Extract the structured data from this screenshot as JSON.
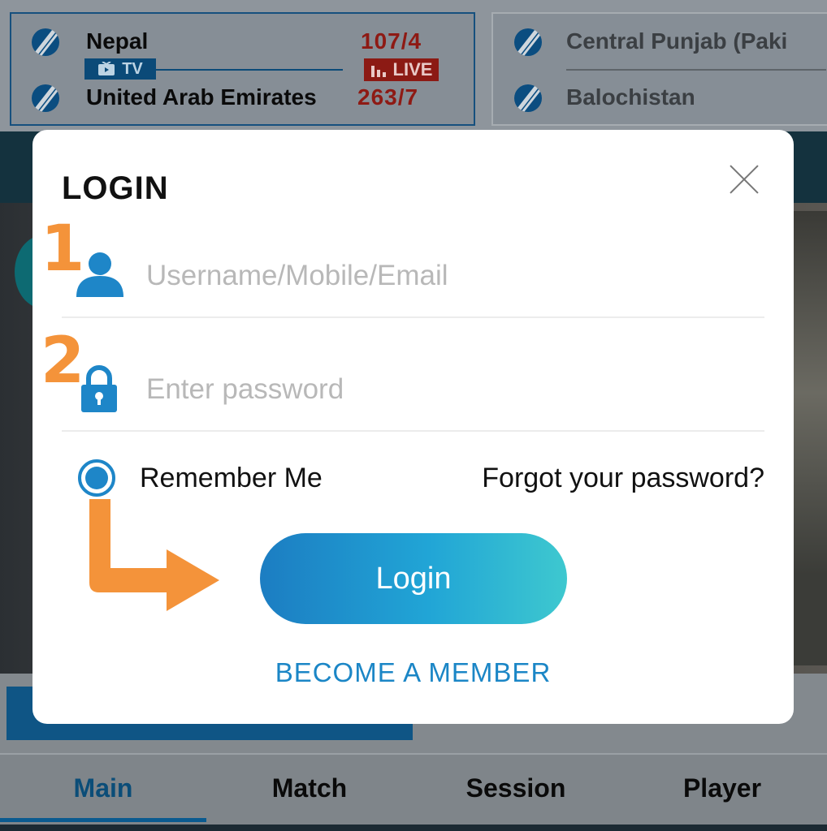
{
  "scoreboard": {
    "left_card": {
      "team1": "Nepal",
      "team1_score": "107/4",
      "team2": "United Arab Emirates",
      "team2_score": "263/7",
      "tv_label": "TV",
      "live_label": "LIVE"
    },
    "right_card": {
      "team1": "Central Punjab (Paki",
      "team2": "Balochistan"
    }
  },
  "login_modal": {
    "title": "LOGIN",
    "step1": "1",
    "step2": "2",
    "username_placeholder": "Username/Mobile/Email",
    "password_placeholder": "Enter password",
    "remember_label": "Remember Me",
    "forgot_label": "Forgot your password?",
    "login_label": "Login",
    "member_label": "BECOME A MEMBER"
  },
  "bottom_nav": {
    "items": [
      {
        "label": "Main",
        "active": true
      },
      {
        "label": "Match",
        "active": false
      },
      {
        "label": "Session",
        "active": false
      },
      {
        "label": "Player",
        "active": false
      }
    ]
  },
  "colors": {
    "accent": "#1e86c8",
    "annotation": "#f4933a",
    "live": "#8c1a14",
    "nav_active": "#0b4d78"
  },
  "icons": [
    "cricket-ball-icon",
    "tv-icon",
    "live-bars-icon",
    "close-icon",
    "user-icon",
    "lock-icon",
    "arrow-annotation"
  ]
}
